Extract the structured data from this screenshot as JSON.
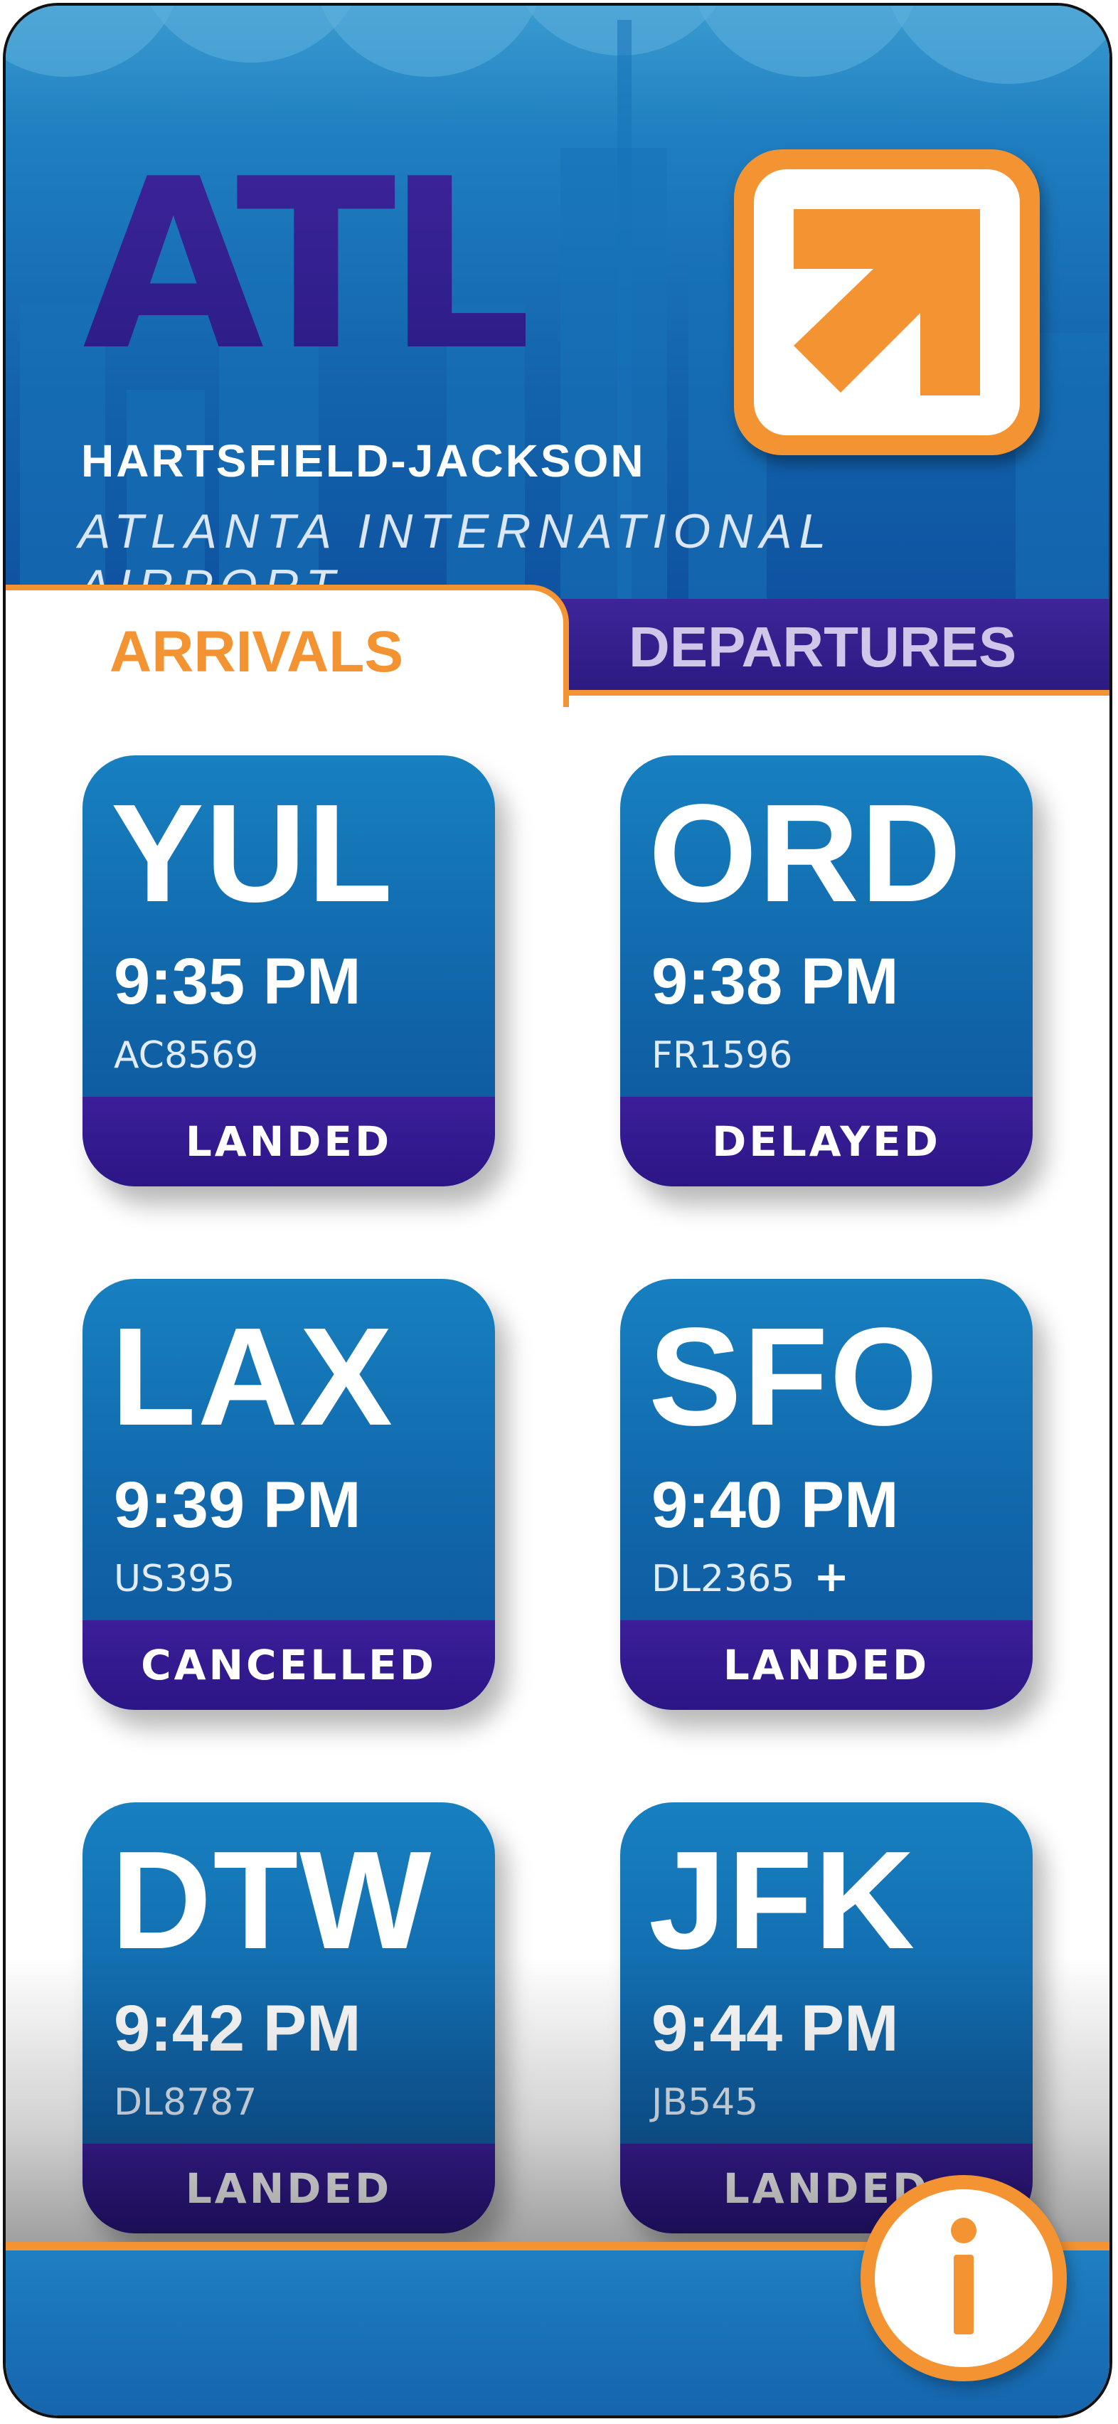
{
  "header": {
    "logo_text": "ATL",
    "logo_icon": "arrow-up-right-icon",
    "airport_name": "HARTSFIELD-JACKSON",
    "airport_subtitle": "ATLANTA INTERNATIONAL AIRPORT"
  },
  "tabs": [
    {
      "label": "ARRIVALS",
      "active": true
    },
    {
      "label": "DEPARTURES",
      "active": false
    }
  ],
  "flights": [
    {
      "code": "YUL",
      "time": "9:35 PM",
      "flight": "AC8569",
      "extra": "",
      "status": "LANDED"
    },
    {
      "code": "ORD",
      "time": "9:38 PM",
      "flight": "FR1596",
      "extra": "",
      "status": "DELAYED"
    },
    {
      "code": "LAX",
      "time": "9:39 PM",
      "flight": "US395",
      "extra": "",
      "status": "CANCELLED"
    },
    {
      "code": "SFO",
      "time": "9:40 PM",
      "flight": "DL2365",
      "extra": "+",
      "status": "LANDED"
    },
    {
      "code": "DTW",
      "time": "9:42 PM",
      "flight": "DL8787",
      "extra": "",
      "status": "LANDED"
    },
    {
      "code": "JFK",
      "time": "9:44 PM",
      "flight": "JB545",
      "extra": "",
      "status": "LANDED"
    }
  ],
  "footer": {
    "info_icon": "info-icon"
  },
  "colors": {
    "accent_orange": "#f39331",
    "brand_blue": "#1064a8",
    "brand_purple": "#2c1585"
  }
}
